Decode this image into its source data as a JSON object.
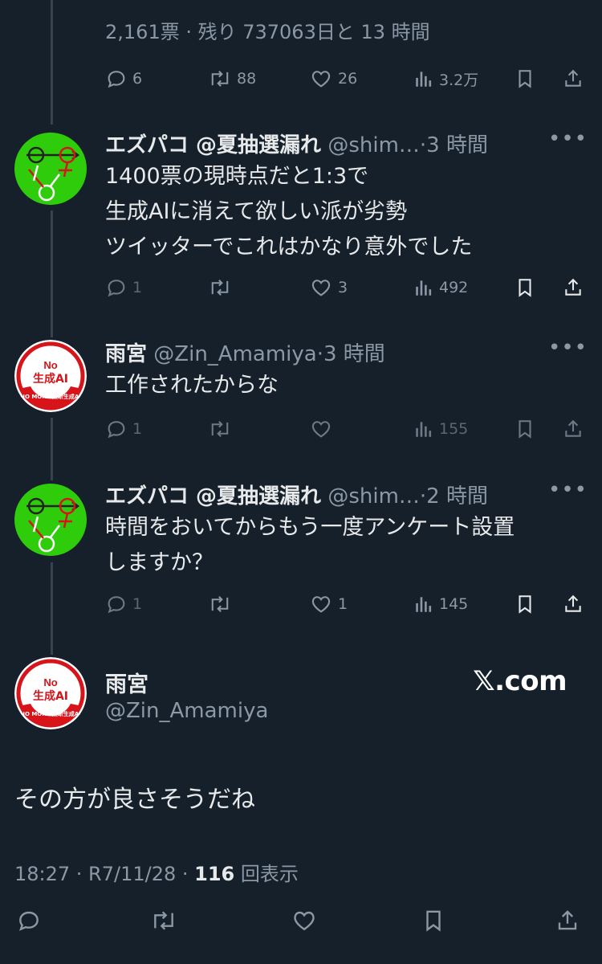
{
  "poll": {
    "meta": "2,161票 · 残り 737063日と 13 時間",
    "actions": {
      "replies": "6",
      "retweets": "88",
      "likes": "26",
      "views": "3.2万"
    }
  },
  "replies": [
    {
      "name": "エズパコ @夏抽選漏れ",
      "handle": "@shim…",
      "dot": "·",
      "time": "3 時間",
      "text": "1400票の現時点だと1:3で\n生成AIに消えて欲しい派が劣勢\nツイッターでこれはかなり意外でした",
      "actions": {
        "replies": "1",
        "retweets": "",
        "likes": "3",
        "views": "492"
      }
    },
    {
      "name": "雨宮",
      "handle": "@Zin_Amamiya",
      "dot": "·",
      "time": "3 時間",
      "text": "工作されたからな",
      "actions": {
        "replies": "1",
        "retweets": "",
        "likes": "",
        "views": "155"
      }
    },
    {
      "name": "エズパコ @夏抽選漏れ",
      "handle": "@shim…",
      "dot": "·",
      "time": "2 時間",
      "text": "時間をおいてからもう一度アンケート設置\nしますか？",
      "actions": {
        "replies": "1",
        "retweets": "",
        "likes": "1",
        "views": "145"
      }
    }
  ],
  "main": {
    "name": "雨宮",
    "handle": "@Zin_Amamiya",
    "text": "その方が良さそうだね",
    "timestamp": "18:27 · R7/11/28 · ",
    "views_count": "116",
    "views_label": " 回表示",
    "watermark": "𝕏.com"
  },
  "avatars": {
    "ezupako": {
      "bg": "#2ecc0a",
      "icon": "gender-symbols-icon"
    },
    "amamiya": {
      "bg": "#ffffff",
      "accent": "#d7141a",
      "badge_top": "No",
      "badge_main": "生成AI",
      "ring_text": "NO MORE 無断生成AI"
    }
  },
  "colors": {
    "background": "#15202b",
    "text": "#e7e9ea",
    "muted": "#8b98a5",
    "divider": "#38444d"
  }
}
